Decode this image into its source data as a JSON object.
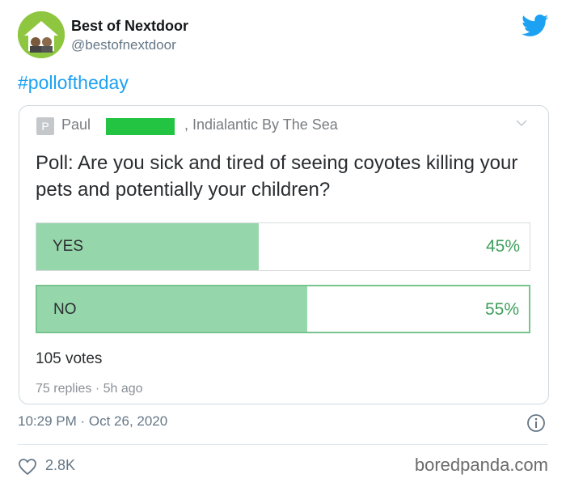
{
  "account": {
    "name": "Best of Nextdoor",
    "handle": "@bestofnextdoor"
  },
  "tweet": {
    "hashtag": "#polloftheday",
    "timestamp": "10:29 PM · Oct 26, 2020",
    "like_count": "2.8K"
  },
  "post": {
    "author_initial": "P",
    "author_name": "Paul",
    "location": ", Indialantic By The Sea",
    "question": "Poll: Are you sick and tired of seeing coyotes killing your pets and potentially your children?",
    "options": [
      {
        "label": "YES",
        "percent_text": "45%",
        "percent": 45,
        "selected": false
      },
      {
        "label": "NO",
        "percent_text": "55%",
        "percent": 55,
        "selected": true
      }
    ],
    "votes": "105 votes",
    "meta": "75 replies · 5h ago"
  },
  "watermark": "boredpanda.com",
  "colors": {
    "brand_blue": "#1da1f2",
    "poll_fill": "#96d6ab",
    "poll_percent": "#3f9f5c",
    "redaction": "#22c441",
    "avatar_green": "#8ec63f"
  },
  "icons": [
    "avatar-logo",
    "twitter-bird-icon",
    "chevron-down-icon",
    "info-icon",
    "heart-icon"
  ]
}
